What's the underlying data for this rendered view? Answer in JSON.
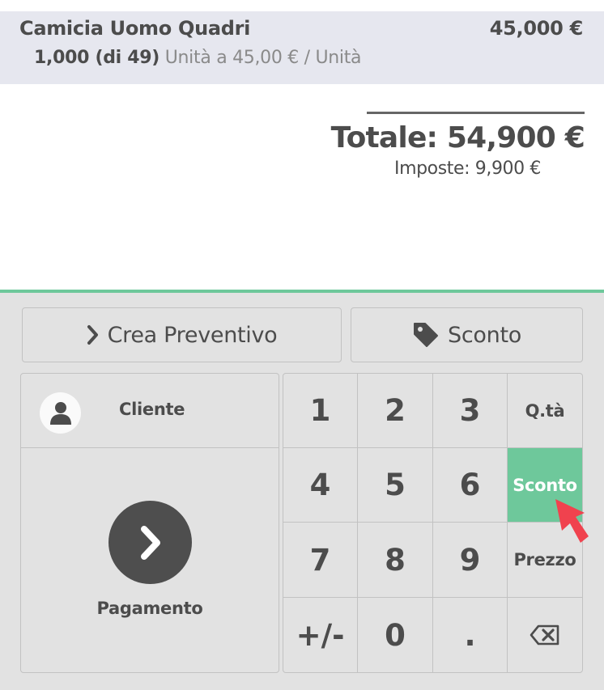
{
  "order_line": {
    "product_name": "Camicia Uomo Quadri",
    "price": "45,000 €",
    "quantity": "1,000 (di 49)",
    "unit_info": "Unità a 45,00 € / Unità"
  },
  "totals": {
    "total": "Totale: 54,900 €",
    "taxes": "Imposte: 9,900 €"
  },
  "control_buttons": {
    "quote_label": "Crea Preventivo",
    "discount_label": "Sconto"
  },
  "actionpad": {
    "customer_label": "Cliente",
    "payment_label": "Pagamento"
  },
  "numpad": {
    "k1": "1",
    "k2": "2",
    "k3": "3",
    "qty": "Q.tà",
    "k4": "4",
    "k5": "5",
    "k6": "6",
    "discount": "Sconto",
    "k7": "7",
    "k8": "8",
    "k9": "9",
    "price": "Prezzo",
    "sign": "+/-",
    "k0": "0",
    "dot": ".",
    "active_mode": "Sconto"
  },
  "icons": {
    "quote": "chevron-right-icon",
    "discount": "tag-icon",
    "customer": "user-icon",
    "payment": "chevron-right-icon",
    "backspace": "backspace-icon"
  },
  "colors": {
    "accent": "#6ec89b",
    "line_background": "#e6e7ef",
    "panel_background": "#e2e2e2",
    "cursor": "#f0424e"
  }
}
